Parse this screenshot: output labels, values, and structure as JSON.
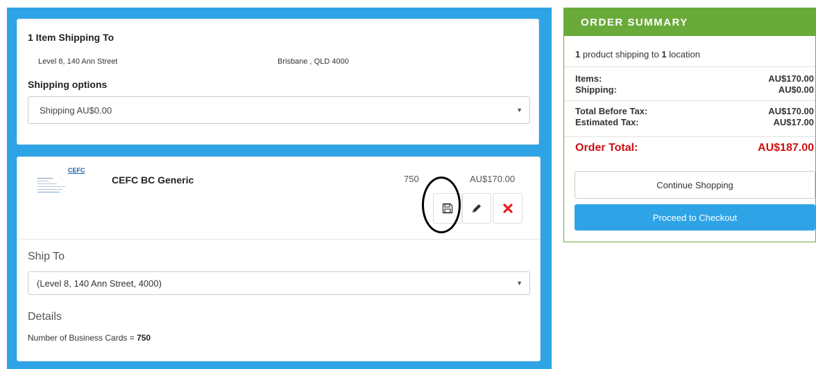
{
  "shipping": {
    "heading": "1 Item Shipping To",
    "address_street": "Level 8, 140 Ann Street",
    "address_city": "Brisbane , QLD 4000",
    "options_label": "Shipping options",
    "options_selected": "Shipping AU$0.00"
  },
  "item": {
    "thumbnail_logo": "CEFC",
    "name": "CEFC BC Generic",
    "quantity": "750",
    "price": "AU$170.00",
    "actions": [
      {
        "name": "save",
        "icon": "floppy-disk-icon"
      },
      {
        "name": "edit",
        "icon": "pencil-icon"
      },
      {
        "name": "delete",
        "icon": "red-x-icon"
      }
    ],
    "ship_to_label": "Ship To",
    "ship_to_selected": "(Level 8, 140 Ann Street, 4000)",
    "details_label": "Details",
    "details_text": "Number of Business Cards = ",
    "details_value": "750"
  },
  "summary": {
    "title": "ORDER SUMMARY",
    "count_products": "1",
    "text_mid": " product shipping to ",
    "count_locations": "1",
    "text_end": " location",
    "items_label": "Items:",
    "items_value": "AU$170.00",
    "shipping_label": "Shipping:",
    "shipping_value": "AU$0.00",
    "before_tax_label": "Total Before Tax:",
    "before_tax_value": "AU$170.00",
    "tax_label": "Estimated Tax:",
    "tax_value": "AU$17.00",
    "total_label": "Order Total:",
    "total_value": "AU$187.00",
    "continue_label": "Continue Shopping",
    "checkout_label": "Proceed to Checkout"
  },
  "colors": {
    "panel_blue": "#2ea4e6",
    "summary_green": "#6aaa3a",
    "total_red": "#cc1111",
    "delete_red": "#e0211d"
  }
}
